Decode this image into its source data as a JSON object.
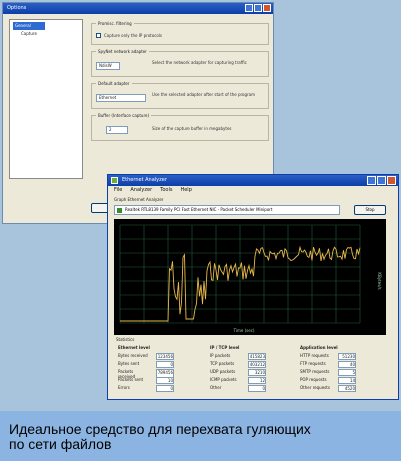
{
  "back_window": {
    "title": "Options",
    "tree_items": [
      "General",
      "Capture"
    ],
    "groups": [
      {
        "label": "Promisc. filtering",
        "check_label": "Capture only the IP protocols"
      },
      {
        "label": "SpyNet network adapter",
        "field": "NdisW",
        "hint": "Select the network adapter for capturing traffic"
      },
      {
        "label": "Default adapter",
        "field": "Ethernet",
        "hint": "Use the selected adapter after start of the program"
      },
      {
        "label": "Buffer (Interface capture)",
        "field": "2",
        "hint": "Size of the capture buffer in megabytes"
      }
    ],
    "ok_label": "",
    "cancel_label": ""
  },
  "front_window": {
    "title": "Ethernet Analyzer",
    "menu": [
      "File",
      "Analyzer",
      "Tools",
      "Help"
    ],
    "toolbar_text": "Graph Ethernet Analyzer",
    "filter_value": "Realtek RTL8139 Family PCI Fast Ethernet NIC - Packet Scheduler Miniport",
    "stop_label": "Stop",
    "y_axis_label": "KBytes/s",
    "x_axis_label": "Time (sec)",
    "stats_header": "Statistics",
    "columns": [
      "Ethernet level",
      "IP / TCP level",
      "Application level"
    ],
    "col1": [
      [
        "Bytes received",
        "123456"
      ],
      [
        "Bytes sent",
        "0"
      ],
      [
        "Packets received",
        "789456"
      ],
      [
        "Packets sent",
        "10"
      ],
      [
        "Errors",
        "0"
      ]
    ],
    "col2": [
      [
        "IP packets",
        "415823"
      ],
      [
        "TCP packets",
        "403212"
      ],
      [
        "UDP packets",
        "3210"
      ],
      [
        "ICMP packets",
        "12"
      ],
      [
        "Other",
        "0"
      ]
    ],
    "col3": [
      [
        "HTTP requests",
        "51230"
      ],
      [
        "FTP requests",
        "40"
      ],
      [
        "SMTP requests",
        "5"
      ],
      [
        "POP requests",
        "14"
      ],
      [
        "Other requests",
        "4520"
      ]
    ]
  },
  "caption": {
    "text": "Идеальное средство для перехвата гуляющих\nпо сети файлов"
  },
  "colors": {
    "graph_bg": "#000000",
    "graph_grid": "#1f5f3a",
    "graph_line": "#e8b84a",
    "caption_bg": "#8bb4e2"
  }
}
